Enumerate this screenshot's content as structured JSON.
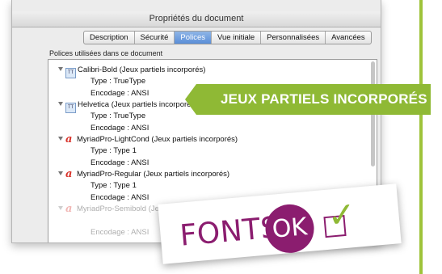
{
  "dialog": {
    "title": "Propriétés du document",
    "tabs": [
      "Description",
      "Sécurité",
      "Polices",
      "Vue initiale",
      "Personnalisées",
      "Avancées"
    ],
    "active_tab": "Polices",
    "section_label": "Polices utilisées dans ce document"
  },
  "fonts": [
    {
      "name": "Calibri-Bold (Jeux partiels incorporés)",
      "icon": "truetype-icon",
      "type": "Type : TrueType",
      "encoding": "Encodage : ANSI"
    },
    {
      "name": "Helvetica (Jeux partiels incorporés)",
      "icon": "truetype-icon",
      "type": "Type : TrueType",
      "encoding": "Encodage : ANSI"
    },
    {
      "name": "MyriadPro-LightCond (Jeux partiels incorporés)",
      "icon": "type1-icon",
      "type": "Type : Type 1",
      "encoding": "Encodage : ANSI"
    },
    {
      "name": "MyriadPro-Regular (Jeux partiels incorporés)",
      "icon": "type1-icon",
      "type": "Type : Type 1",
      "encoding": "Encodage : ANSI"
    },
    {
      "name": "MyriadPro-Semibold (Jeux partiels incorporés)",
      "icon": "type1-icon",
      "type": "",
      "encoding": "Encodage : ANSI"
    }
  ],
  "callout": {
    "text": "JEUX PARTIELS INCORPORÉS"
  },
  "badge": {
    "label": "FONTS :",
    "ok": "OK",
    "check": "✓"
  },
  "colors": {
    "accent_green": "#8fb935",
    "purple": "#8b1d6f",
    "selected_tab": "#5a8ed8"
  }
}
